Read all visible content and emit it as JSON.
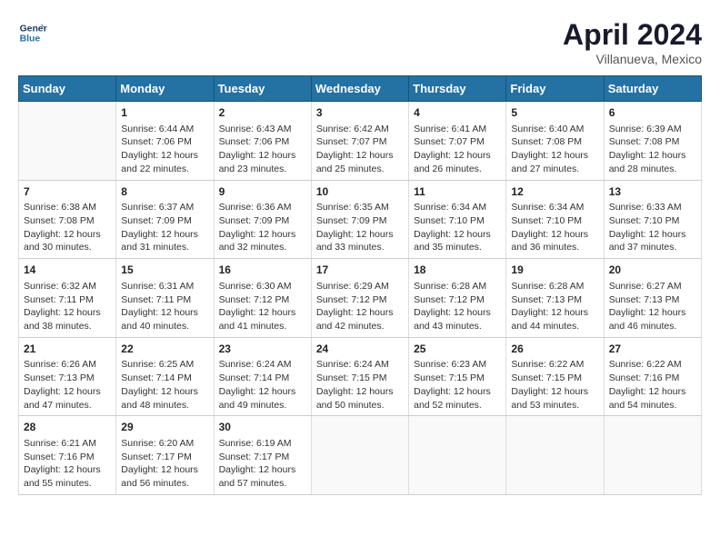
{
  "header": {
    "logo_line1": "General",
    "logo_line2": "Blue",
    "title": "April 2024",
    "subtitle": "Villanueva, Mexico"
  },
  "days_of_week": [
    "Sunday",
    "Monday",
    "Tuesday",
    "Wednesday",
    "Thursday",
    "Friday",
    "Saturday"
  ],
  "weeks": [
    [
      {
        "day": "",
        "content": ""
      },
      {
        "day": "1",
        "content": "Sunrise: 6:44 AM\nSunset: 7:06 PM\nDaylight: 12 hours\nand 22 minutes."
      },
      {
        "day": "2",
        "content": "Sunrise: 6:43 AM\nSunset: 7:06 PM\nDaylight: 12 hours\nand 23 minutes."
      },
      {
        "day": "3",
        "content": "Sunrise: 6:42 AM\nSunset: 7:07 PM\nDaylight: 12 hours\nand 25 minutes."
      },
      {
        "day": "4",
        "content": "Sunrise: 6:41 AM\nSunset: 7:07 PM\nDaylight: 12 hours\nand 26 minutes."
      },
      {
        "day": "5",
        "content": "Sunrise: 6:40 AM\nSunset: 7:08 PM\nDaylight: 12 hours\nand 27 minutes."
      },
      {
        "day": "6",
        "content": "Sunrise: 6:39 AM\nSunset: 7:08 PM\nDaylight: 12 hours\nand 28 minutes."
      }
    ],
    [
      {
        "day": "7",
        "content": "Sunrise: 6:38 AM\nSunset: 7:08 PM\nDaylight: 12 hours\nand 30 minutes."
      },
      {
        "day": "8",
        "content": "Sunrise: 6:37 AM\nSunset: 7:09 PM\nDaylight: 12 hours\nand 31 minutes."
      },
      {
        "day": "9",
        "content": "Sunrise: 6:36 AM\nSunset: 7:09 PM\nDaylight: 12 hours\nand 32 minutes."
      },
      {
        "day": "10",
        "content": "Sunrise: 6:35 AM\nSunset: 7:09 PM\nDaylight: 12 hours\nand 33 minutes."
      },
      {
        "day": "11",
        "content": "Sunrise: 6:34 AM\nSunset: 7:10 PM\nDaylight: 12 hours\nand 35 minutes."
      },
      {
        "day": "12",
        "content": "Sunrise: 6:34 AM\nSunset: 7:10 PM\nDaylight: 12 hours\nand 36 minutes."
      },
      {
        "day": "13",
        "content": "Sunrise: 6:33 AM\nSunset: 7:10 PM\nDaylight: 12 hours\nand 37 minutes."
      }
    ],
    [
      {
        "day": "14",
        "content": "Sunrise: 6:32 AM\nSunset: 7:11 PM\nDaylight: 12 hours\nand 38 minutes."
      },
      {
        "day": "15",
        "content": "Sunrise: 6:31 AM\nSunset: 7:11 PM\nDaylight: 12 hours\nand 40 minutes."
      },
      {
        "day": "16",
        "content": "Sunrise: 6:30 AM\nSunset: 7:12 PM\nDaylight: 12 hours\nand 41 minutes."
      },
      {
        "day": "17",
        "content": "Sunrise: 6:29 AM\nSunset: 7:12 PM\nDaylight: 12 hours\nand 42 minutes."
      },
      {
        "day": "18",
        "content": "Sunrise: 6:28 AM\nSunset: 7:12 PM\nDaylight: 12 hours\nand 43 minutes."
      },
      {
        "day": "19",
        "content": "Sunrise: 6:28 AM\nSunset: 7:13 PM\nDaylight: 12 hours\nand 44 minutes."
      },
      {
        "day": "20",
        "content": "Sunrise: 6:27 AM\nSunset: 7:13 PM\nDaylight: 12 hours\nand 46 minutes."
      }
    ],
    [
      {
        "day": "21",
        "content": "Sunrise: 6:26 AM\nSunset: 7:13 PM\nDaylight: 12 hours\nand 47 minutes."
      },
      {
        "day": "22",
        "content": "Sunrise: 6:25 AM\nSunset: 7:14 PM\nDaylight: 12 hours\nand 48 minutes."
      },
      {
        "day": "23",
        "content": "Sunrise: 6:24 AM\nSunset: 7:14 PM\nDaylight: 12 hours\nand 49 minutes."
      },
      {
        "day": "24",
        "content": "Sunrise: 6:24 AM\nSunset: 7:15 PM\nDaylight: 12 hours\nand 50 minutes."
      },
      {
        "day": "25",
        "content": "Sunrise: 6:23 AM\nSunset: 7:15 PM\nDaylight: 12 hours\nand 52 minutes."
      },
      {
        "day": "26",
        "content": "Sunrise: 6:22 AM\nSunset: 7:15 PM\nDaylight: 12 hours\nand 53 minutes."
      },
      {
        "day": "27",
        "content": "Sunrise: 6:22 AM\nSunset: 7:16 PM\nDaylight: 12 hours\nand 54 minutes."
      }
    ],
    [
      {
        "day": "28",
        "content": "Sunrise: 6:21 AM\nSunset: 7:16 PM\nDaylight: 12 hours\nand 55 minutes."
      },
      {
        "day": "29",
        "content": "Sunrise: 6:20 AM\nSunset: 7:17 PM\nDaylight: 12 hours\nand 56 minutes."
      },
      {
        "day": "30",
        "content": "Sunrise: 6:19 AM\nSunset: 7:17 PM\nDaylight: 12 hours\nand 57 minutes."
      },
      {
        "day": "",
        "content": ""
      },
      {
        "day": "",
        "content": ""
      },
      {
        "day": "",
        "content": ""
      },
      {
        "day": "",
        "content": ""
      }
    ]
  ]
}
